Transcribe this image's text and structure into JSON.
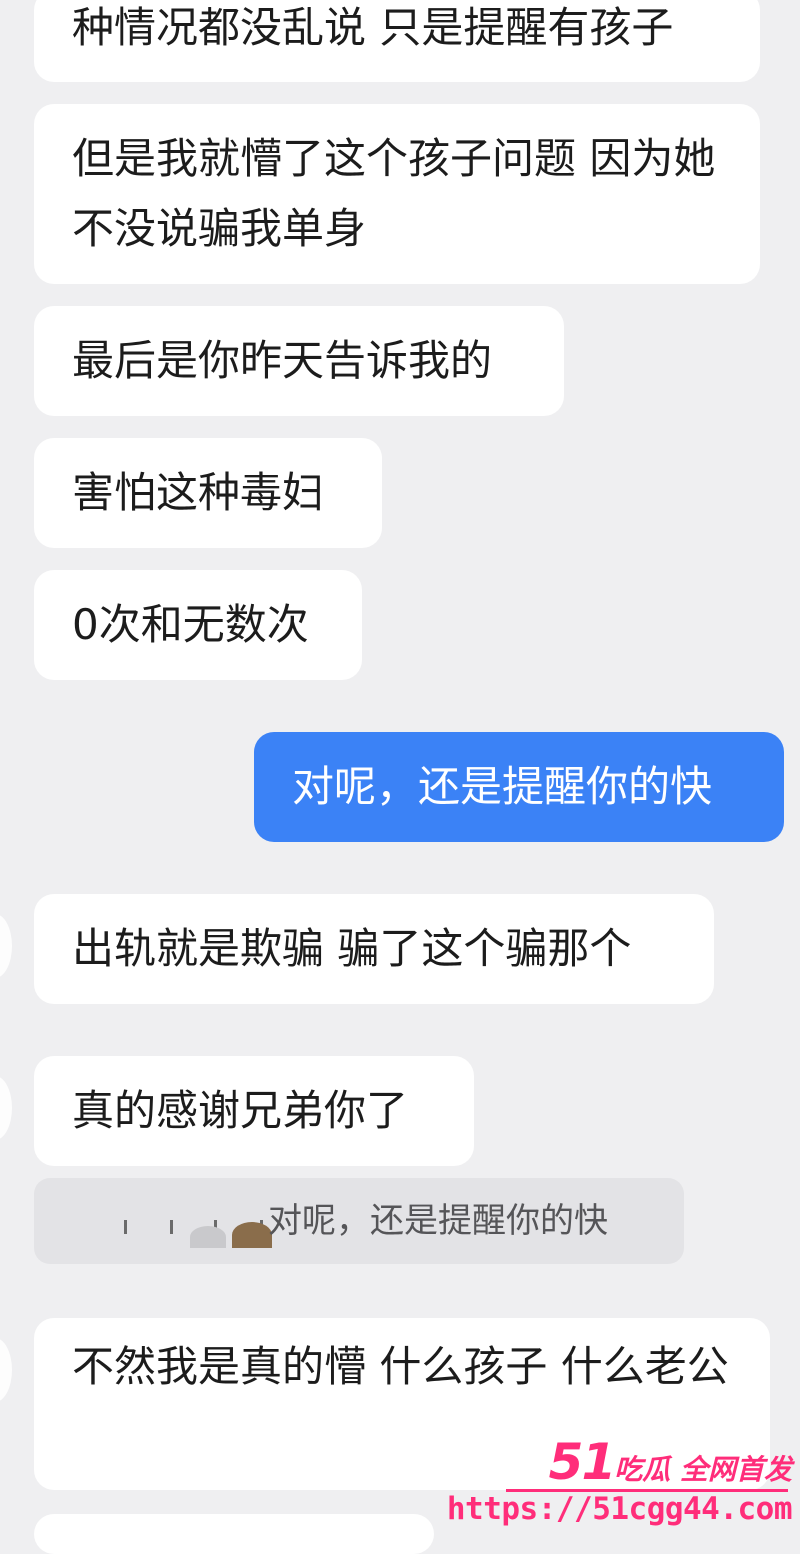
{
  "messages": [
    {
      "side": "received",
      "text": "种情况都没乱说 只是提醒有孩子"
    },
    {
      "side": "received",
      "text": "但是我就懵了这个孩子问题 因为她不没说骗我单身"
    },
    {
      "side": "received",
      "text": "最后是你昨天告诉我的"
    },
    {
      "side": "received",
      "text": "害怕这种毒妇"
    },
    {
      "side": "received",
      "text": "0次和无数次"
    },
    {
      "side": "sent",
      "text": "对呢，还是提醒你的快"
    },
    {
      "side": "received",
      "text": "出轨就是欺骗 骗了这个骗那个"
    },
    {
      "side": "received",
      "text": "真的感谢兄弟你了"
    },
    {
      "side": "received",
      "text": "不然我是真的懵 什么孩子 什么老公"
    }
  ],
  "quote": {
    "text": "对呢，还是提醒你的快"
  },
  "watermark": {
    "logo_number": "51",
    "logo_text": "吃瓜 全网首发",
    "url": "https://51cgg44.com"
  },
  "colors": {
    "background": "#efeff1",
    "received_bubble": "#ffffff",
    "sent_bubble": "#3b82f6",
    "watermark": "#ff2d7a"
  }
}
